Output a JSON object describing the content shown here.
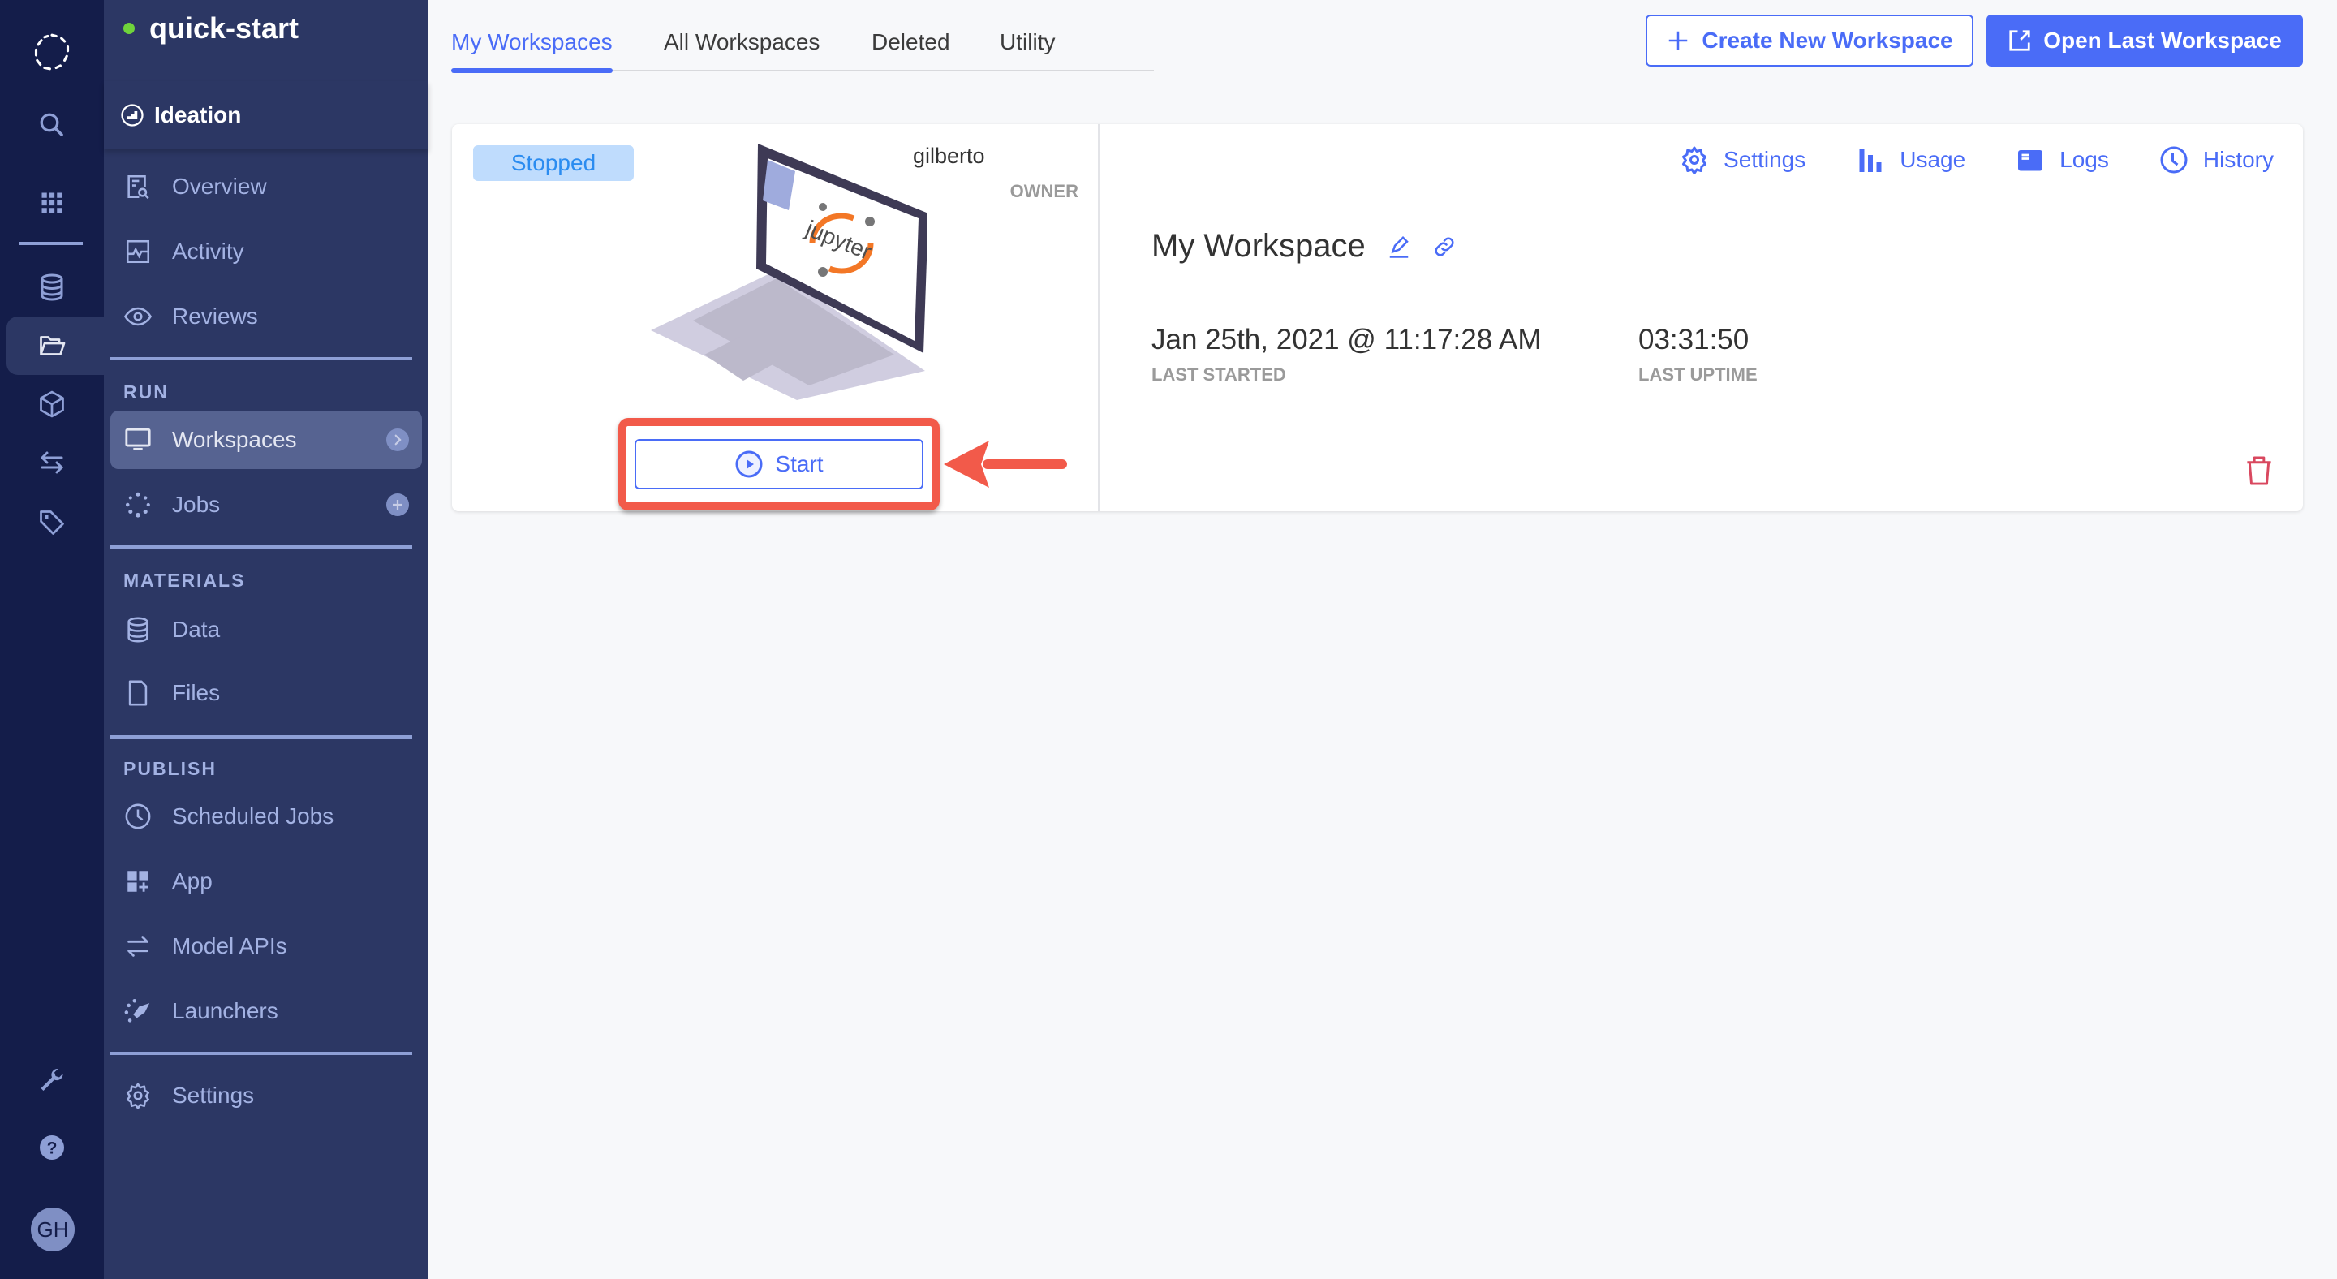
{
  "project": {
    "name": "quick-start",
    "status_color": "#6fd43b"
  },
  "stage": {
    "label": "Ideation"
  },
  "rail": {
    "icons": [
      "logo-icon",
      "search-icon",
      "apps-grid-icon",
      "database-icon",
      "folder-open-icon",
      "cube-icon",
      "transfer-icon",
      "tag-icon",
      "wrench-icon",
      "help-icon"
    ],
    "avatar_initials": "GH"
  },
  "sidebar": {
    "ideation_items": [
      {
        "label": "Overview",
        "icon": "overview-icon"
      },
      {
        "label": "Activity",
        "icon": "activity-icon"
      },
      {
        "label": "Reviews",
        "icon": "eye-icon"
      }
    ],
    "run_title": "RUN",
    "run_items": [
      {
        "label": "Workspaces",
        "icon": "monitor-icon",
        "active": true
      },
      {
        "label": "Jobs",
        "icon": "jobs-spinner-icon"
      }
    ],
    "materials_title": "MATERIALS",
    "materials_items": [
      {
        "label": "Data",
        "icon": "database-icon"
      },
      {
        "label": "Files",
        "icon": "file-icon"
      }
    ],
    "publish_title": "PUBLISH",
    "publish_items": [
      {
        "label": "Scheduled Jobs",
        "icon": "clock-icon"
      },
      {
        "label": "App",
        "icon": "app-icon"
      },
      {
        "label": "Model APIs",
        "icon": "swap-icon"
      },
      {
        "label": "Launchers",
        "icon": "rocket-icon"
      }
    ],
    "settings_label": "Settings"
  },
  "tabs": [
    {
      "label": "My Workspaces",
      "active": true
    },
    {
      "label": "All Workspaces"
    },
    {
      "label": "Deleted"
    },
    {
      "label": "Utility"
    }
  ],
  "toolbar": {
    "create_label": "Create New Workspace",
    "open_last_label": "Open Last Workspace"
  },
  "workspace": {
    "status": "Stopped",
    "owner_name": "gilberto",
    "owner_role": "OWNER",
    "illustration": "jupyter-laptop",
    "illustration_text": "jupyter",
    "start_label": "Start",
    "actions": [
      {
        "label": "Settings",
        "icon": "gear-icon"
      },
      {
        "label": "Usage",
        "icon": "bar-chart-icon"
      },
      {
        "label": "Logs",
        "icon": "logs-icon"
      },
      {
        "label": "History",
        "icon": "history-clock-icon"
      }
    ],
    "name": "My Workspace",
    "last_started_value": "Jan 25th, 2021 @ 11:17:28 AM",
    "last_started_label": "LAST STARTED",
    "last_uptime_value": "03:31:50",
    "last_uptime_label": "LAST UPTIME"
  },
  "colors": {
    "accent": "#4a6cf7",
    "rail_bg": "#141d4a",
    "sidebar_bg": "#2c3764",
    "status_bg": "#bfdcfd",
    "status_text": "#2b8cf0",
    "annotation": "#f25a4a",
    "delete": "#d9485f"
  }
}
